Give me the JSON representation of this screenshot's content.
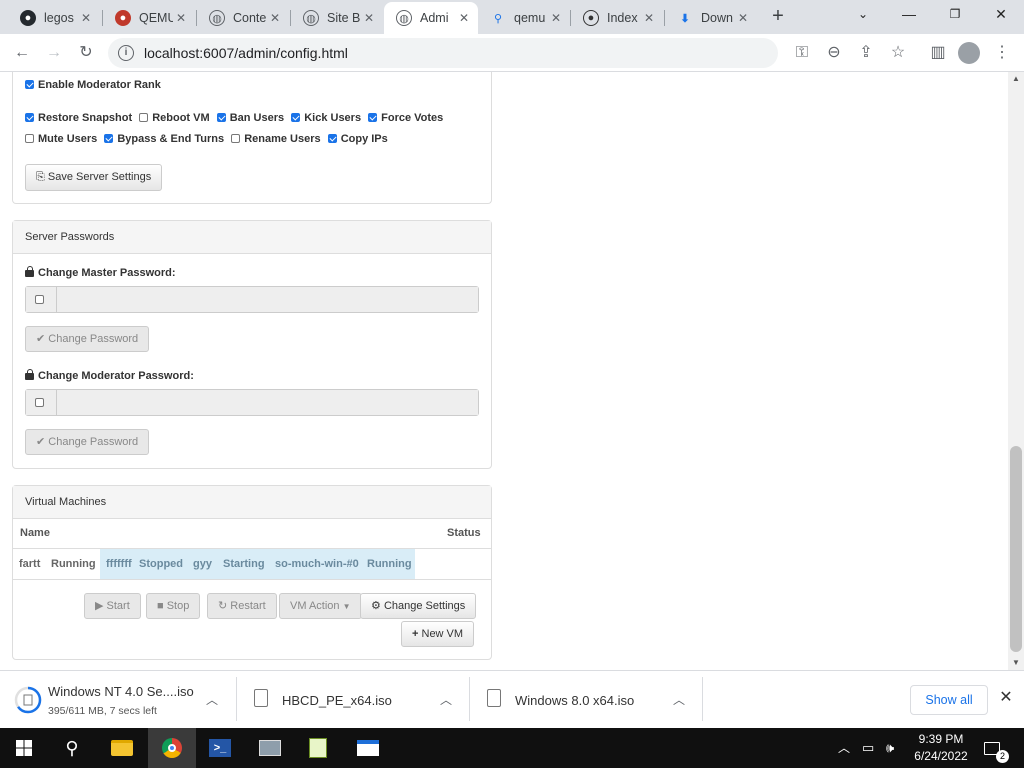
{
  "browser": {
    "tabs": [
      {
        "title": "legos",
        "icon": "github-icon",
        "active": false
      },
      {
        "title": "QEMU",
        "icon": "qemu-icon",
        "active": false
      },
      {
        "title": "Conte",
        "icon": "globe-icon",
        "active": false
      },
      {
        "title": "Site B",
        "icon": "globe-icon",
        "active": false
      },
      {
        "title": "Admi",
        "icon": "globe-icon",
        "active": true
      },
      {
        "title": "qemu",
        "icon": "search-icon",
        "active": false
      },
      {
        "title": "Index",
        "icon": "github-octocat-icon",
        "active": false
      },
      {
        "title": "Down",
        "icon": "download-icon",
        "active": false
      }
    ],
    "url": "localhost:6007/admin/config.html"
  },
  "server_settings": {
    "moderator_rank_label": "Enable Moderator Rank",
    "moderator_rank_checked": true,
    "permissions_row1": [
      {
        "label": "Restore Snapshot",
        "checked": true
      },
      {
        "label": "Reboot VM",
        "checked": false
      },
      {
        "label": "Ban Users",
        "checked": true
      },
      {
        "label": "Kick Users",
        "checked": true
      },
      {
        "label": "Force Votes",
        "checked": true
      }
    ],
    "permissions_row2": [
      {
        "label": "Mute Users",
        "checked": false
      },
      {
        "label": "Bypass & End Turns",
        "checked": true
      },
      {
        "label": "Rename Users",
        "checked": false
      },
      {
        "label": "Copy IPs",
        "checked": true
      }
    ],
    "save_button": "Save Server Settings"
  },
  "passwords": {
    "title": "Server Passwords",
    "master_label": "Change Master Password:",
    "moderator_label": "Change Moderator Password:",
    "change_button": "Change Password"
  },
  "virtual_machines": {
    "title": "Virtual Machines",
    "col_name": "Name",
    "col_status": "Status",
    "vms": [
      {
        "name": "fartt",
        "status": "Running",
        "highlight": false
      },
      {
        "name": "fffffff",
        "status": "Stopped",
        "highlight": true
      },
      {
        "name": "gyy",
        "status": "Starting",
        "highlight": true
      },
      {
        "name": "so-much-win-#0",
        "status": "Running",
        "highlight": true
      }
    ],
    "buttons": {
      "start": "Start",
      "stop": "Stop",
      "restart": "Restart",
      "vm_action": "VM Action",
      "change_settings": "Change Settings",
      "new_vm": "New VM"
    }
  },
  "downloads": {
    "items": [
      {
        "name": "Windows NT 4.0 Se....iso",
        "status": "395/611 MB, 7 secs left",
        "progress": 0.65
      },
      {
        "name": "HBCD_PE_x64.iso",
        "status": ""
      },
      {
        "name": "Windows 8.0 x64.iso",
        "status": ""
      }
    ],
    "show_all": "Show all"
  },
  "taskbar": {
    "time": "9:39 PM",
    "date": "6/24/2022",
    "notifications": "2"
  }
}
